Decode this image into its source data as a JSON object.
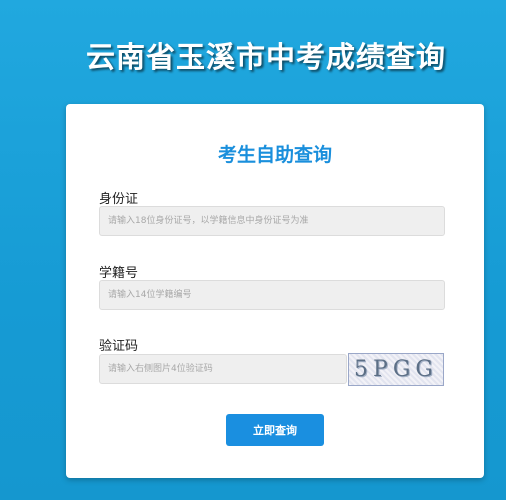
{
  "page": {
    "title": "云南省玉溪市中考成绩查询"
  },
  "form": {
    "heading": "考生自助查询",
    "id_card": {
      "label": "身份证",
      "placeholder": "请输入18位身份证号，以学籍信息中身份证号为准",
      "value": ""
    },
    "student_no": {
      "label": "学籍号",
      "placeholder": "请输入14位学籍编号",
      "value": ""
    },
    "captcha": {
      "label": "验证码",
      "placeholder": "请输入右侧图片4位验证码",
      "value": "",
      "image_text": "5PGG"
    },
    "submit_label": "立即查询"
  },
  "colors": {
    "background": "#1aa0d8",
    "accent": "#1a8fe0",
    "heading": "#1a8fdc"
  }
}
